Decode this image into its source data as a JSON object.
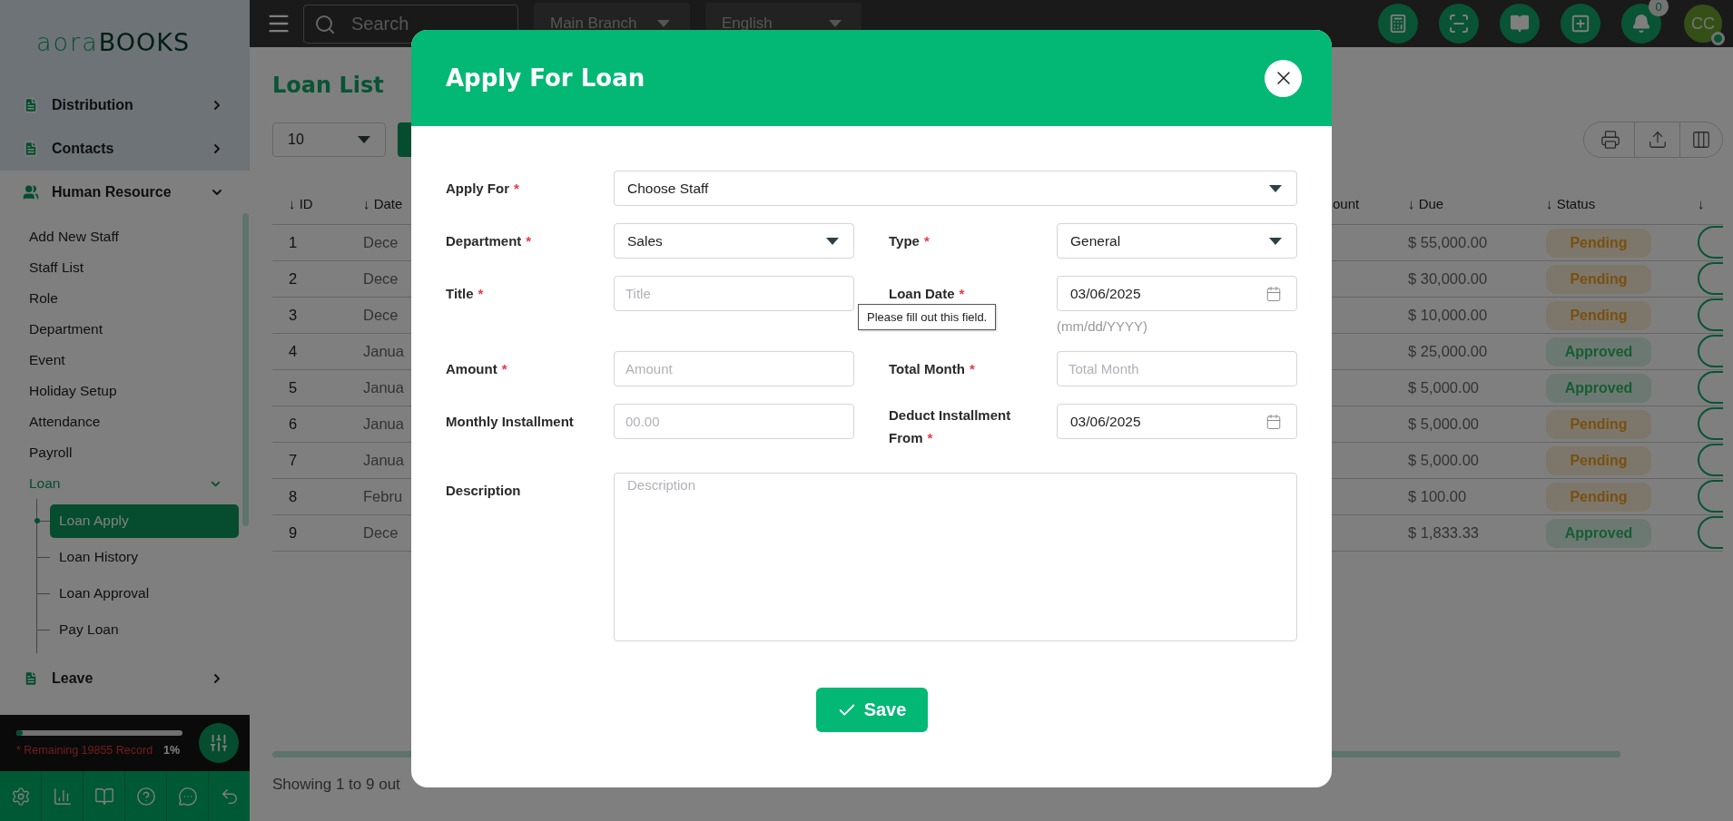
{
  "topbar": {
    "search": {
      "placeholder": "Search"
    },
    "branch_select": {
      "value": "Main Branch"
    },
    "language_select": {
      "value": "English"
    },
    "notifications": {
      "count": "0"
    },
    "avatar": {
      "initials": "CC"
    }
  },
  "sidebar": {
    "logo": {
      "light": "aora",
      "bold": "BOOKS"
    },
    "sections": [
      {
        "label": "Distribution",
        "expanded": false
      },
      {
        "label": "Contacts",
        "expanded": false
      },
      {
        "label": "Human Resource",
        "expanded": true,
        "children": [
          {
            "label": "Add New Staff",
            "selected": false
          },
          {
            "label": "Staff List",
            "selected": false
          },
          {
            "label": "Role",
            "selected": false
          },
          {
            "label": "Department",
            "selected": false
          },
          {
            "label": "Event",
            "selected": false
          },
          {
            "label": "Holiday Setup",
            "selected": false
          },
          {
            "label": "Attendance",
            "selected": false
          },
          {
            "label": "Payroll",
            "selected": false
          },
          {
            "label": "Loan",
            "selected": false,
            "expanded": true,
            "children": [
              {
                "label": "Loan Apply",
                "selected": true
              },
              {
                "label": "Loan History",
                "selected": false
              },
              {
                "label": "Loan Approval",
                "selected": false
              },
              {
                "label": "Pay Loan",
                "selected": false
              }
            ]
          }
        ]
      },
      {
        "label": "Leave",
        "expanded": false
      }
    ],
    "usage": {
      "level": 0.04,
      "text": "* Remaining 19855 Record",
      "percent": "1%"
    }
  },
  "page": {
    "title": "Loan List",
    "page_size": "10",
    "table": {
      "columns": [
        "↓ ID",
        "↓ Date",
        "ount",
        "↓ Due",
        "↓ Status",
        "↓"
      ],
      "rows": [
        {
          "id": "1",
          "date": "Dece",
          "due": "$ 55,000.00",
          "status": "Pending",
          "kind": "pending"
        },
        {
          "id": "2",
          "date": "Dece",
          "due": "$ 30,000.00",
          "status": "Pending",
          "kind": "pending"
        },
        {
          "id": "3",
          "date": "Dece",
          "due": "$ 10,000.00",
          "status": "Pending",
          "kind": "pending"
        },
        {
          "id": "4",
          "date": "Janua",
          "due": "$ 25,000.00",
          "status": "Approved",
          "kind": "approved"
        },
        {
          "id": "5",
          "date": "Janua",
          "due": "$ 5,000.00",
          "status": "Approved",
          "kind": "approved"
        },
        {
          "id": "6",
          "date": "Janua",
          "due": "$ 5,000.00",
          "status": "Pending",
          "kind": "pending"
        },
        {
          "id": "7",
          "date": "Janua",
          "due": "$ 5,000.00",
          "status": "Pending",
          "kind": "pending"
        },
        {
          "id": "8",
          "date": "Febru",
          "due": "$ 100.00",
          "status": "Pending",
          "kind": "pending"
        },
        {
          "id": "9",
          "date": "Dece",
          "due": "$ 1,833.33",
          "status": "Approved",
          "kind": "approved"
        }
      ]
    },
    "footer": "Showing 1 to 9 out"
  },
  "modal": {
    "title": "Apply For Loan",
    "rows": [
      [
        {
          "kind": "select",
          "label": "Apply For",
          "required_mark": "*",
          "value": "Choose Staff"
        }
      ],
      [
        {
          "kind": "select",
          "label": "Department",
          "required_mark": "*",
          "value": "Sales"
        },
        {
          "kind": "select",
          "label": "Type",
          "required_mark": "*",
          "value": "General"
        }
      ],
      [
        {
          "kind": "text",
          "label": "Title",
          "required_mark": "*",
          "placeholder": "Title",
          "tooltip": "Please fill out this field."
        },
        {
          "kind": "date",
          "label": "Loan Date",
          "required_mark": "*",
          "value": "03/06/2025",
          "hint": "(mm/dd/YYYY)"
        }
      ],
      [
        {
          "kind": "text",
          "label": "Amount",
          "required_mark": "*",
          "placeholder": "Amount"
        },
        {
          "kind": "text",
          "label": "Total Month",
          "required_mark": "*",
          "placeholder": "Total Month"
        }
      ],
      [
        {
          "kind": "text",
          "label": "Monthly Installment",
          "placeholder": "00.00"
        },
        {
          "kind": "date",
          "label": "Deduct Installment From",
          "required_mark": "*",
          "value": "03/06/2025"
        }
      ],
      [
        {
          "kind": "textarea",
          "label": "Description",
          "placeholder": "Description"
        }
      ]
    ],
    "save_button": "Save"
  }
}
